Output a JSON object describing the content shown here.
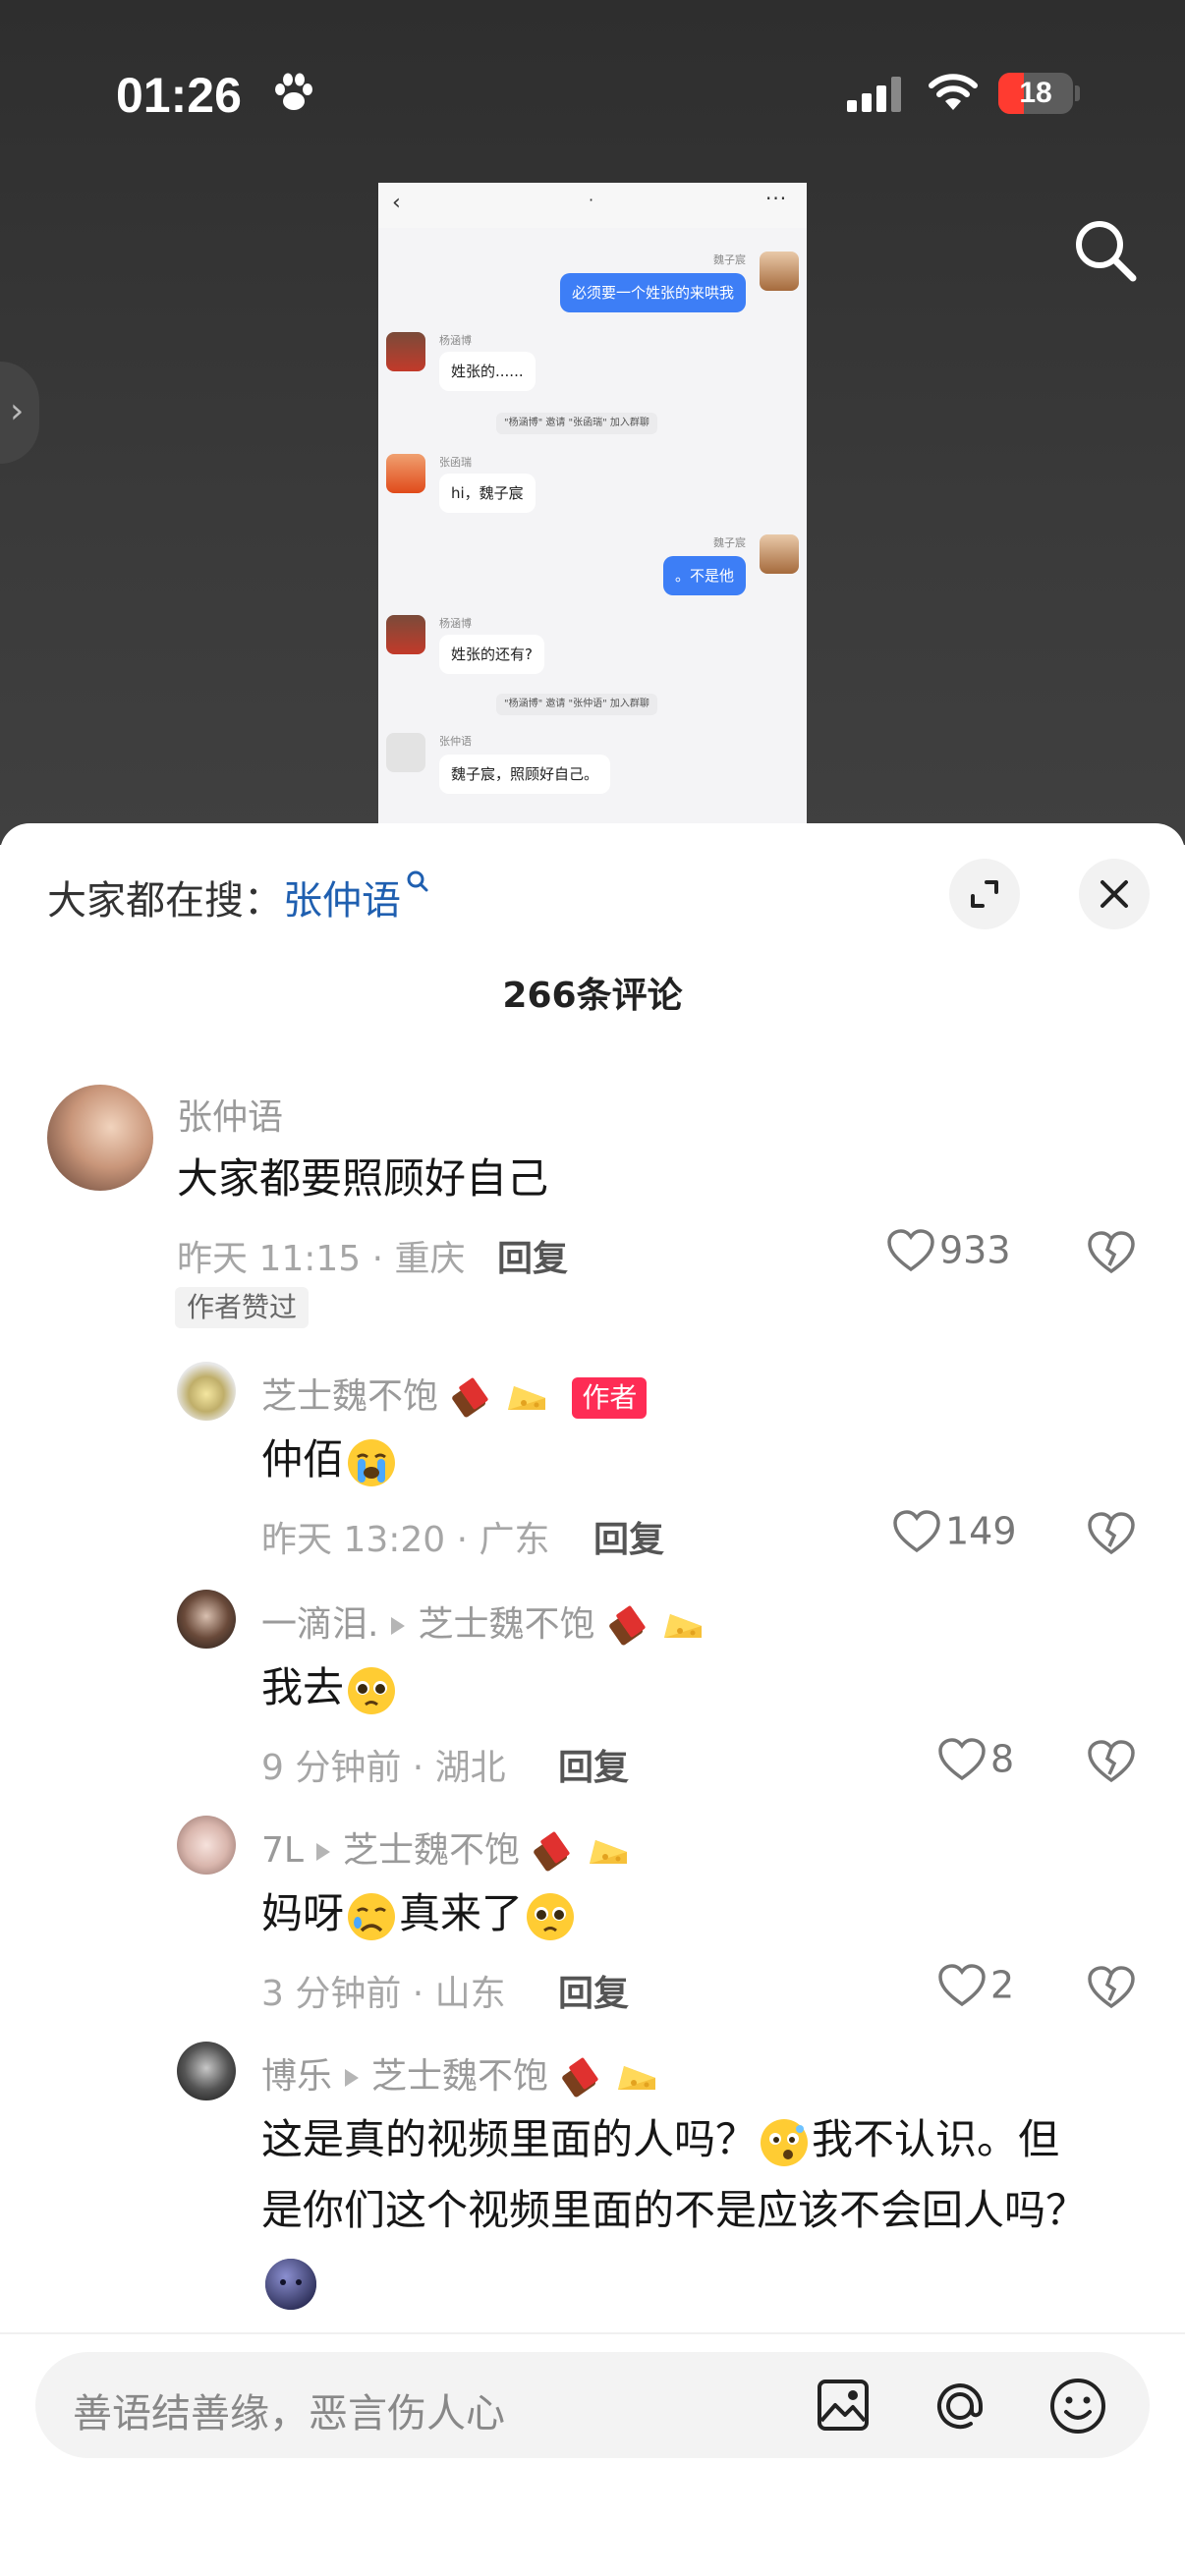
{
  "status_bar": {
    "time": "01:26",
    "battery": "18"
  },
  "chat_screenshot": {
    "messages": [
      {
        "name": "魏子宸",
        "text": "必须要一个姓张的来哄我"
      },
      {
        "name": "杨涵博",
        "text": "姓张的......"
      },
      {
        "system": "\"杨涵博\" 邀请 \"张函瑞\" 加入群聊"
      },
      {
        "name": "张函瑞",
        "text": "hi，魏子宸"
      },
      {
        "name": "魏子宸",
        "text": "。不是他"
      },
      {
        "name": "杨涵博",
        "text": "姓张的还有?"
      },
      {
        "system": "\"杨涵博\" 邀请 \"张仲语\" 加入群聊"
      },
      {
        "name": "张仲语",
        "text": "魏子宸，照顾好自己。"
      }
    ]
  },
  "sheet": {
    "search_prefix": "大家都在搜：",
    "search_term": "张仲语",
    "comment_count": "266条评论"
  },
  "comments": [
    {
      "user": "张仲语",
      "text": "大家都要照顾好自己",
      "meta": "昨天 11:15 · 重庆",
      "reply": "回复",
      "likes": "933",
      "tag": "作者赞过"
    },
    {
      "user": "芝士魏不饱",
      "author_badge": "作者",
      "text": "仲佰",
      "meta": "昨天 13:20 · 广东",
      "reply": "回复",
      "likes": "149"
    },
    {
      "user": "一滴泪.",
      "reply_to": "芝士魏不饱",
      "text": "我去",
      "meta": "9 分钟前 · 湖北",
      "reply": "回复",
      "likes": "8"
    },
    {
      "user": "7L",
      "reply_to": "芝士魏不饱",
      "text_a": "妈呀",
      "text_b": "真来了",
      "meta": "3 分钟前 · 山东",
      "reply": "回复",
      "likes": "2"
    },
    {
      "user": "博乐",
      "reply_to": "芝士魏不饱",
      "line1_a": "这是真的视频里面的人吗？",
      "line1_b": "我不认识。但",
      "line2": "是你们这个视频里面的不是应该不会回人吗？"
    }
  ],
  "input": {
    "placeholder": "善语结善缘，恶言伤人心"
  },
  "colors": {
    "accent": "#fe2c55",
    "search_term": "#1f5fb0",
    "bubble_me": "#3d7ef6"
  }
}
